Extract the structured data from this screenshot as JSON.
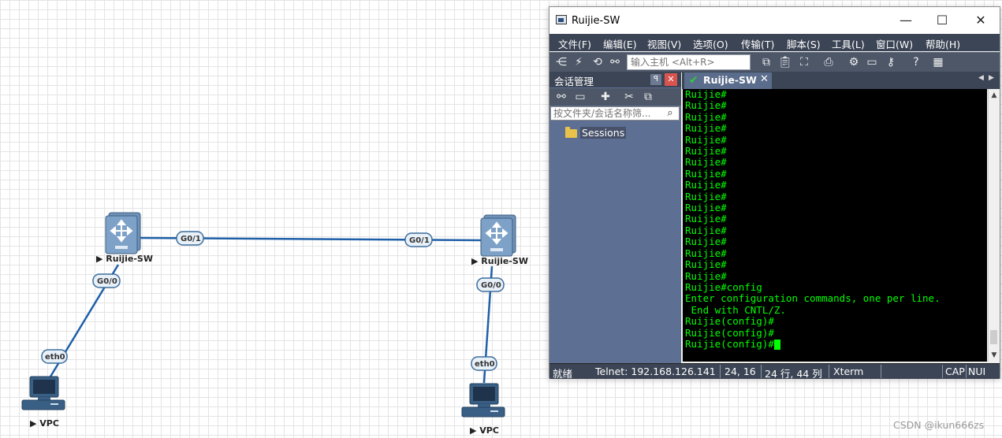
{
  "topology": {
    "switch_left_label": "▶ Ruijie-SW",
    "switch_right_label": "▶ Ruijie-SW",
    "vpc_left_label": "▶ VPC",
    "vpc_right_label": "▶ VPC",
    "ports": {
      "left_g01": "G0/1",
      "right_g01": "G0/1",
      "left_g00": "G0/0",
      "right_g00": "G0/0",
      "left_eth0": "eth0",
      "right_eth0": "eth0"
    },
    "link_color": "#1f5fa8"
  },
  "window": {
    "title": "Ruijie-SW",
    "minimize": "—",
    "maximize": "☐",
    "close": "✕"
  },
  "menu": [
    "文件(F)",
    "编辑(E)",
    "视图(V)",
    "选项(O)",
    "传输(T)",
    "脚本(S)",
    "工具(L)",
    "窗口(W)",
    "帮助(H)"
  ],
  "toolbar": {
    "host_placeholder": "输入主机 <Alt+R>",
    "icons": [
      "connect-icon",
      "quick-connect-icon",
      "reconnect-icon",
      "link-icon",
      "copy-icon",
      "paste-icon",
      "find-icon",
      "print-icon",
      "settings-icon",
      "keymap-icon",
      "keys-icon",
      "help-icon",
      "sftp-icon"
    ]
  },
  "sidebar": {
    "title": "会话管理",
    "pin": "ꟼ",
    "close": "✕",
    "filter_placeholder": "按文件夹/会话名称筛...",
    "folder": "Sessions"
  },
  "tab": {
    "label": "Ruijie-SW",
    "close": "✕",
    "nav_left": "◀",
    "nav_right": "▶"
  },
  "terminal": {
    "lines": [
      "Ruijie#",
      "Ruijie#",
      "Ruijie#",
      "Ruijie#",
      "Ruijie#",
      "Ruijie#",
      "Ruijie#",
      "Ruijie#",
      "Ruijie#",
      "Ruijie#",
      "Ruijie#",
      "Ruijie#",
      "Ruijie#",
      "Ruijie#",
      "Ruijie#",
      "Ruijie#",
      "Ruijie#",
      "Ruijie#config",
      "Enter configuration commands, one per line.",
      " End with CNTL/Z.",
      "Ruijie(config)#",
      "Ruijie(config)#"
    ],
    "prompt": "Ruijie(config)#",
    "text_color": "#00ff00",
    "bg_color": "#000000"
  },
  "status": {
    "ready": "就绪",
    "connection": "Telnet: 192.168.126.141",
    "cursor_pos": "24,  16",
    "size": "24 行, 44 列",
    "terminal_type": "Xterm",
    "cap": "CAP",
    "num": "NUI"
  },
  "watermark": "CSDN @ikun666zs"
}
